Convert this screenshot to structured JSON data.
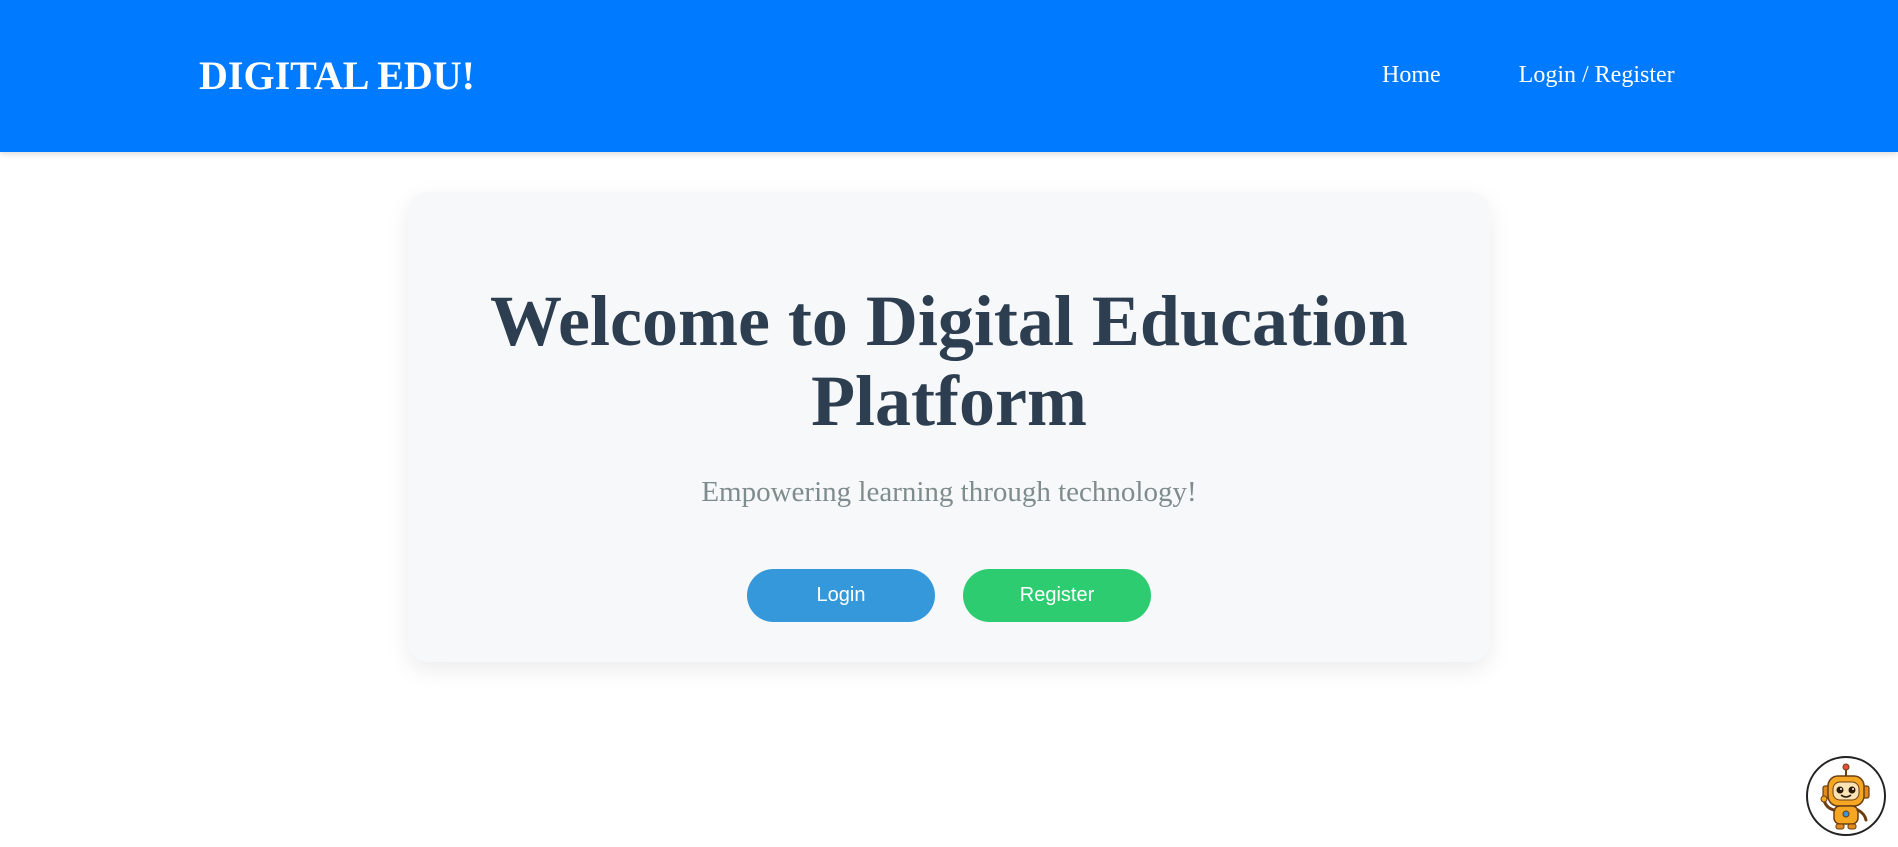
{
  "header": {
    "brand": "DIGITAL EDU!",
    "nav": [
      {
        "label": "Home"
      },
      {
        "label": "Login / Register"
      }
    ]
  },
  "hero": {
    "title": "Welcome to Digital Education Platform",
    "subtitle": "Empowering learning through technology!",
    "login_label": "Login",
    "register_label": "Register"
  },
  "chat_widget": {
    "icon": "robot-icon"
  },
  "colors": {
    "header_bg": "#007bff",
    "login_button": "#3498db",
    "register_button": "#2ecc71",
    "title_text": "#2c3e50",
    "subtitle_text": "#7f8c8d"
  }
}
